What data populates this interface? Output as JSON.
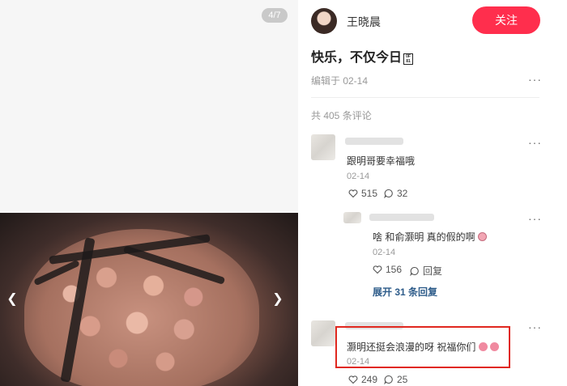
{
  "media": {
    "counter": "4/7",
    "prev_icon": "chevron-left-icon",
    "next_icon": "chevron-right-icon"
  },
  "author": {
    "name": "王晓晨",
    "follow_label": "关注"
  },
  "post": {
    "title": "快乐，不仅今日",
    "title_glyph": "0F 81",
    "edited": "编辑于 02-14"
  },
  "comments_header": "共 405 条评论",
  "comments": [
    {
      "text": "跟明哥要幸福哦",
      "date": "02-14",
      "likes": "515",
      "replies": "32"
    },
    {
      "text": "啥 和俞灏明 真的假的啊",
      "emoji": "pig-face-emoji",
      "date": "02-14",
      "likes": "156",
      "reply_label": "回复"
    },
    {
      "text": "灏明还挺会浪漫的呀 祝福你们",
      "emoji": "tulip-emoji",
      "date": "02-14",
      "likes": "249",
      "replies": "25"
    }
  ],
  "expand_label": "展开 31 条回复",
  "colors": {
    "accent": "#ff2e4d",
    "link": "#2e5c8a",
    "highlight": "#e0281f"
  }
}
